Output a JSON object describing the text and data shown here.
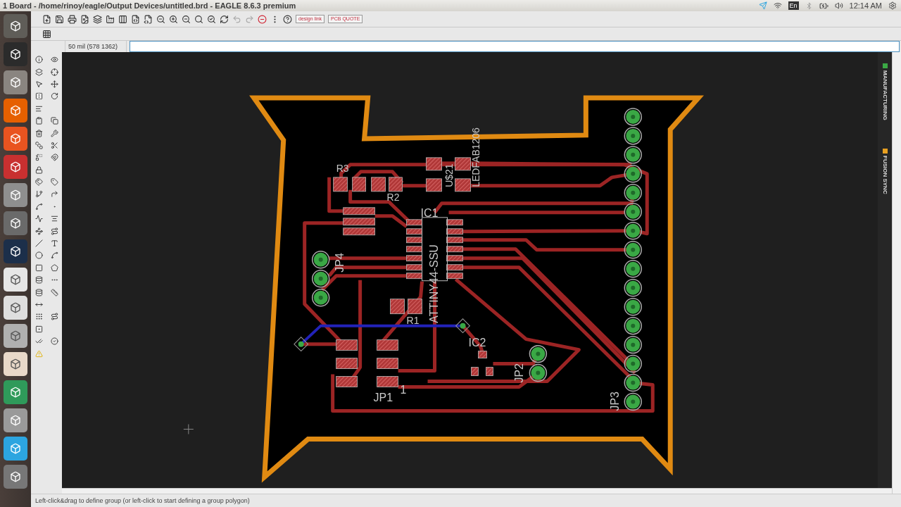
{
  "window": {
    "title": "1 Board - /home/rinoy/eagle/Output Devices/untitled.brd - EAGLE 8.6.3 premium"
  },
  "tray": {
    "keyboard": "En",
    "time": "12:14 AM"
  },
  "toolbar": {
    "badges": [
      "design link",
      "PCB QUOTE"
    ]
  },
  "command_bar": {
    "grid_status": "50 mil (578 1362)"
  },
  "side_tabs": [
    {
      "label": "MANUFACTURING",
      "color": "#3aa845"
    },
    {
      "label": "FUSION SYNC",
      "color": "#e8a020"
    }
  ],
  "board": {
    "labels": [
      {
        "text": "R3",
        "vertical": false
      },
      {
        "text": "R2",
        "vertical": false
      },
      {
        "text": "U$21",
        "vertical": true
      },
      {
        "text": "LEDFAB1206",
        "vertical": true
      },
      {
        "text": "IC1",
        "vertical": false
      },
      {
        "text": "ATTINY44-SSU",
        "vertical": true
      },
      {
        "text": "JP4",
        "vertical": true
      },
      {
        "text": "R1",
        "vertical": false
      },
      {
        "text": "IC2",
        "vertical": false
      },
      {
        "text": "JP2",
        "vertical": true
      },
      {
        "text": "1",
        "vertical": false
      },
      {
        "text": "JP1",
        "vertical": false
      },
      {
        "text": "JP3",
        "vertical": true
      }
    ]
  },
  "status_bar": "Left-click&drag to define group (or left-click to start defining a group polygon)"
}
